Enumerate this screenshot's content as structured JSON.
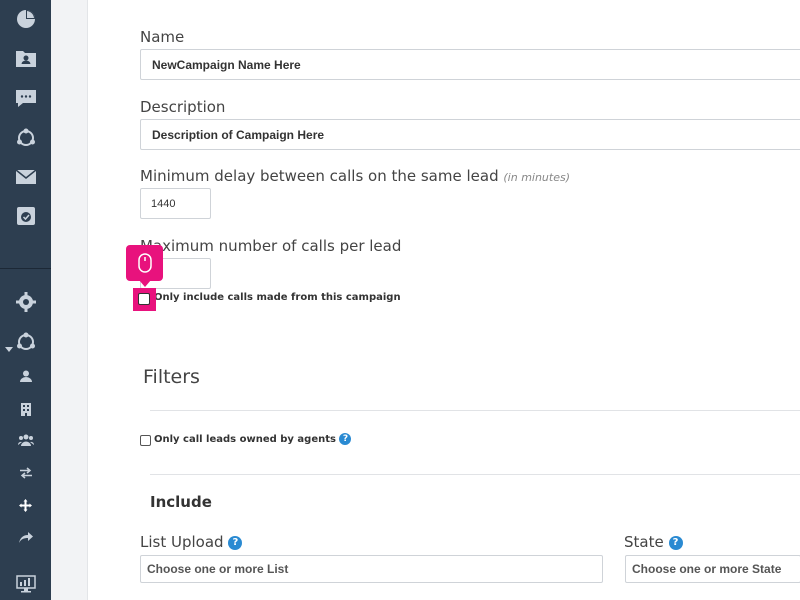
{
  "sidebar": {
    "icons": [
      "dashboard-icon",
      "contacts-folder-icon",
      "chat-icon",
      "campaign-nodes-icon",
      "mail-icon",
      "task-check-icon"
    ],
    "bottom_icons": [
      "settings-gear-icon",
      "campaign-nodes-icon",
      "user-icon",
      "building-icon",
      "users-group-icon",
      "transfer-icon",
      "move-icon",
      "forward-icon",
      "monitor-icon"
    ]
  },
  "form": {
    "name_label": "Name",
    "name_value": "NewCampaign Name Here",
    "description_label": "Description",
    "description_value": "Description of Campaign Here",
    "delay_label": "Minimum delay between calls on the same lead",
    "delay_hint": "(in minutes)",
    "delay_value": "1440",
    "max_calls_label": "Maximum number of calls per lead",
    "max_calls_value": "",
    "only_campaign_label": "Only include calls made from this campaign"
  },
  "filters": {
    "title": "Filters",
    "agents_label": "Only call leads owned by agents",
    "help_glyph": "?"
  },
  "include": {
    "title": "Include",
    "list_upload_label": "List Upload",
    "list_upload_placeholder": "Choose one or more List",
    "state_label": "State",
    "state_placeholder": "Choose one or more State"
  },
  "colors": {
    "sidebar": "#2d3e50",
    "accent": "#e8127d",
    "help": "#2a8ad2"
  }
}
